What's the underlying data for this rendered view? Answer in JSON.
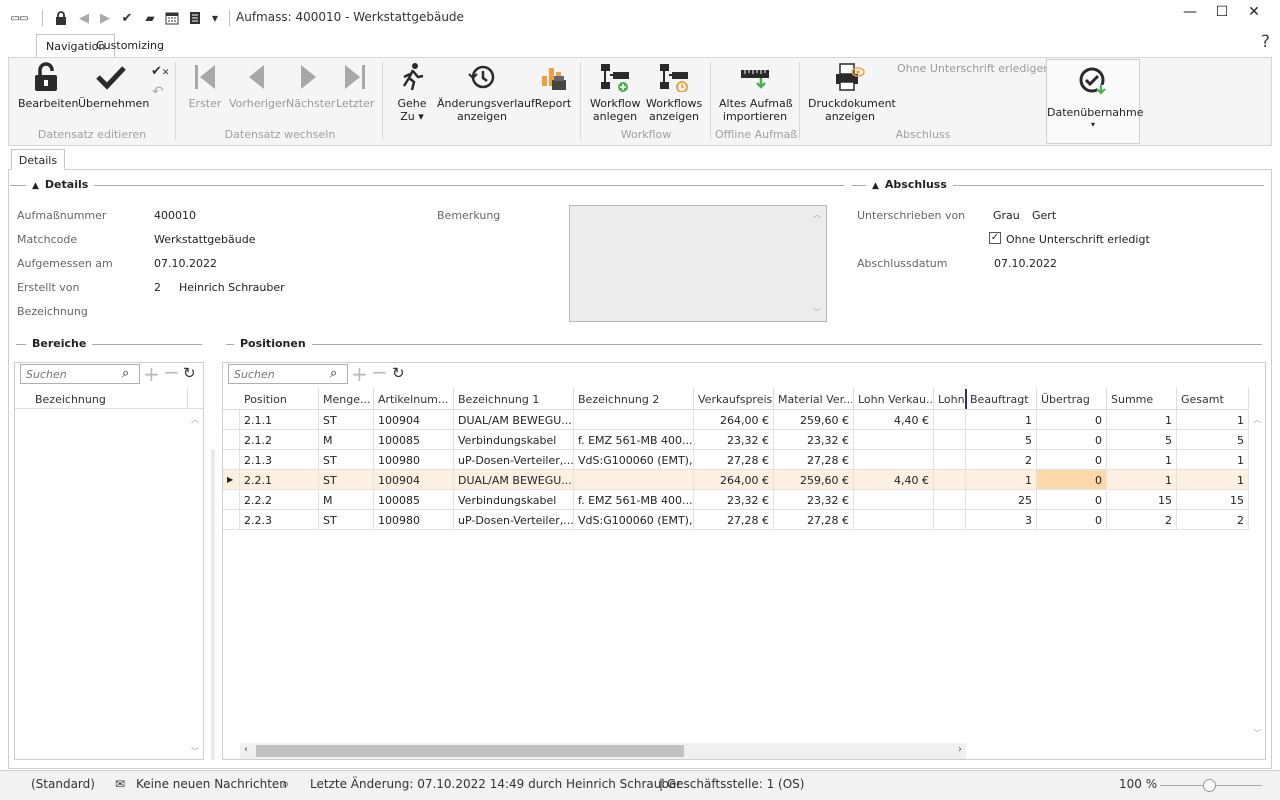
{
  "window": {
    "title": "Aufmass: 400010 - Werkstattgebäude"
  },
  "ribbon_tabs": [
    "Navigation",
    "Customizing"
  ],
  "ribbon": {
    "buttons": {
      "bearbeiten": "Bearbeiten",
      "uebernehmen": "Übernehmen",
      "erster": "Erster",
      "vorheriger": "Vorheriger",
      "naechster": "Nächster",
      "letzter": "Letzter",
      "gehe_zu_1": "Gehe",
      "gehe_zu_2": "Zu ▾",
      "aenderung_1": "Änderungsverlauf",
      "aenderung_2": "anzeigen",
      "report": "Report",
      "wf_anlegen_1": "Workflow",
      "wf_anlegen_2": "anlegen",
      "wf_anzeigen_1": "Workflows",
      "wf_anzeigen_2": "anzeigen",
      "altes_1": "Altes Aufmaß",
      "altes_2": "importieren",
      "druck_1": "Druckdokument",
      "druck_2": "anzeigen",
      "ohne_unterschrift": "Ohne Unterschrift erledigen",
      "datenuebernahme": "Datenübernahme",
      "datenuebernahme_arrow": "▾"
    },
    "groups": {
      "datensatz_editieren": "Datensatz editieren",
      "datensatz_wechseln": "Datensatz wechseln",
      "workflow": "Workflow",
      "offline": "Offline Aufmaß",
      "abschluss": "Abschluss"
    }
  },
  "detail_tab": "Details",
  "details": {
    "section_title": "Details",
    "aufmassnummer_label": "Aufmaßnummer",
    "aufmassnummer": "400010",
    "matchcode_label": "Matchcode",
    "matchcode": "Werkstattgebäude",
    "aufgemessen_label": "Aufgemessen am",
    "aufgemessen": "07.10.2022",
    "erstellt_label": "Erstellt von",
    "erstellt_nr": "2",
    "erstellt_name": "Heinrich Schrauber",
    "bezeichnung_label": "Bezeichnung",
    "bemerkung_label": "Bemerkung"
  },
  "abschluss": {
    "section_title": "Abschluss",
    "unterschrieben_label": "Unterschrieben von",
    "unterschrieben_nachname": "Grau",
    "unterschrieben_vorname": "Gert",
    "ohne_unterschrift_label": "Ohne Unterschrift erledigt",
    "ohne_unterschrift_checked": true,
    "abschlussdatum_label": "Abschlussdatum",
    "abschlussdatum": "07.10.2022"
  },
  "bereiche": {
    "section_title": "Bereiche",
    "search_placeholder": "Suchen",
    "column": "Bezeichnung"
  },
  "positionen": {
    "section_title": "Positionen",
    "search_placeholder": "Suchen",
    "columns": [
      "Position",
      "Menge...",
      "Artikelnum...",
      "Bezeichnung 1",
      "Bezeichnung 2",
      "Verkaufspreis",
      "Material Ver...",
      "Lohn Verkau...",
      "Lohnk",
      "Beauftragt",
      "Übertrag",
      "Summe",
      "Gesamt"
    ],
    "rows": [
      [
        "2.1.1",
        "ST",
        "100904",
        "DUAL/AM BEWEGU...",
        "",
        "264,00 €",
        "259,60 €",
        "4,40 €",
        "",
        "1",
        "0",
        "1",
        "1"
      ],
      [
        "2.1.2",
        "M",
        "100085",
        "Verbindungskabel",
        "f. EMZ 561-MB 400...",
        "23,32 €",
        "23,32 €",
        "",
        "",
        "5",
        "0",
        "5",
        "5"
      ],
      [
        "2.1.3",
        "ST",
        "100980",
        "uP-Dosen-Verteiler,...",
        "VdS:G100060 (EMT),...",
        "27,28 €",
        "27,28 €",
        "",
        "",
        "2",
        "0",
        "1",
        "1"
      ],
      [
        "2.2.1",
        "ST",
        "100904",
        "DUAL/AM BEWEGU...",
        "",
        "264,00 €",
        "259,60 €",
        "4,40 €",
        "",
        "1",
        "0",
        "1",
        "1"
      ],
      [
        "2.2.2",
        "M",
        "100085",
        "Verbindungskabel",
        "f. EMZ 561-MB 400...",
        "23,32 €",
        "23,32 €",
        "",
        "",
        "25",
        "0",
        "15",
        "15"
      ],
      [
        "2.2.3",
        "ST",
        "100980",
        "uP-Dosen-Verteiler,...",
        "VdS:G100060 (EMT),...",
        "27,28 €",
        "27,28 €",
        "",
        "",
        "3",
        "0",
        "2",
        "2"
      ]
    ],
    "selected_row": 3
  },
  "statusbar": {
    "layout": "(Standard)",
    "messages": "Keine neuen Nachrichten",
    "last_change": "Letzte Änderung: 07.10.2022 14:49 durch Heinrich Schrauber",
    "branch": "| Geschäftsstelle:  1 (OS)",
    "zoom": "100 %"
  },
  "colors": {
    "selected_row": "#fdf0e1",
    "selected_cell": "#fcd9a9",
    "accent": "#1e1e1e"
  }
}
